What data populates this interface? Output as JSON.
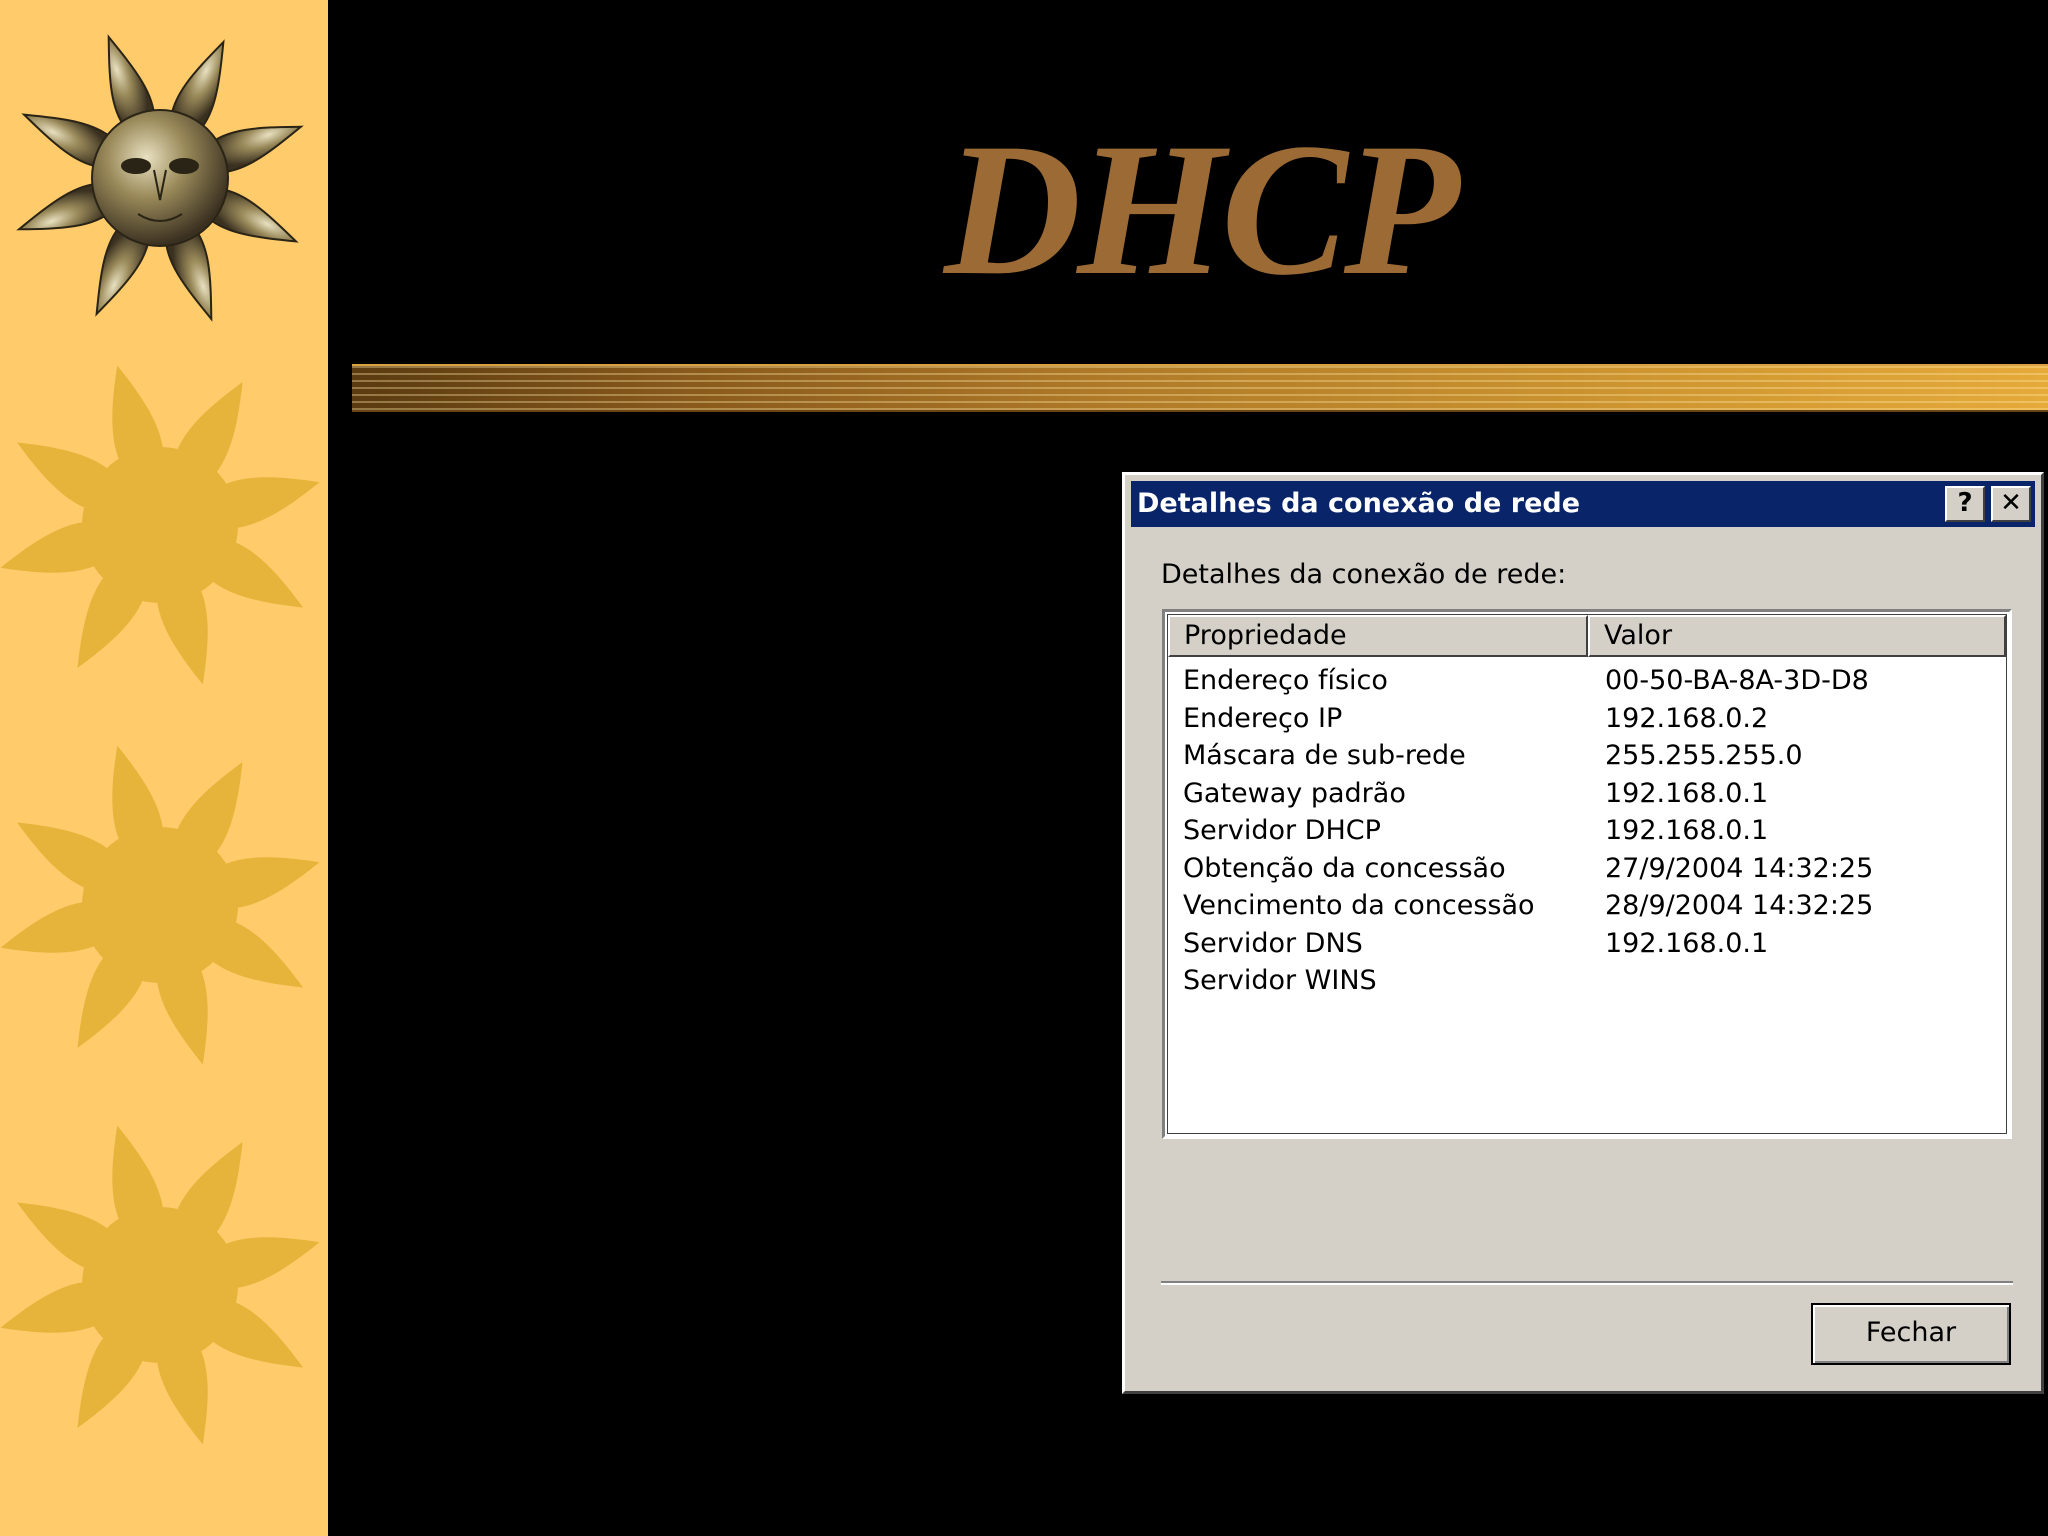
{
  "slide": {
    "title": "DHCP",
    "background_color": "#000000",
    "side_strip_color": "#FFCB6B",
    "title_color": "#9B6A35",
    "decoration_icons": [
      "sun-face-icon",
      "sun-icon",
      "sun-icon",
      "sun-icon"
    ]
  },
  "dialog": {
    "title": "Detalhes da conexão de rede",
    "help_label": "?",
    "close_label": "✕",
    "group_label": "Detalhes da conexão de rede:",
    "columns": [
      "Propriedade",
      "Valor"
    ],
    "rows": [
      {
        "property": "Endereço físico",
        "value": "00-50-BA-8A-3D-D8"
      },
      {
        "property": "Endereço IP",
        "value": "192.168.0.2"
      },
      {
        "property": "Máscara de sub-rede",
        "value": "255.255.255.0"
      },
      {
        "property": "Gateway padrão",
        "value": "192.168.0.1"
      },
      {
        "property": "Servidor DHCP",
        "value": "192.168.0.1"
      },
      {
        "property": "Obtenção da concessão",
        "value": "27/9/2004 14:32:25"
      },
      {
        "property": "Vencimento da concessão",
        "value": "28/9/2004 14:32:25"
      },
      {
        "property": "Servidor DNS",
        "value": "192.168.0.1"
      },
      {
        "property": "Servidor WINS",
        "value": ""
      }
    ],
    "button_label": "Fechar",
    "titlebar_color": "#0A246A",
    "face_color": "#D4D0C8"
  }
}
